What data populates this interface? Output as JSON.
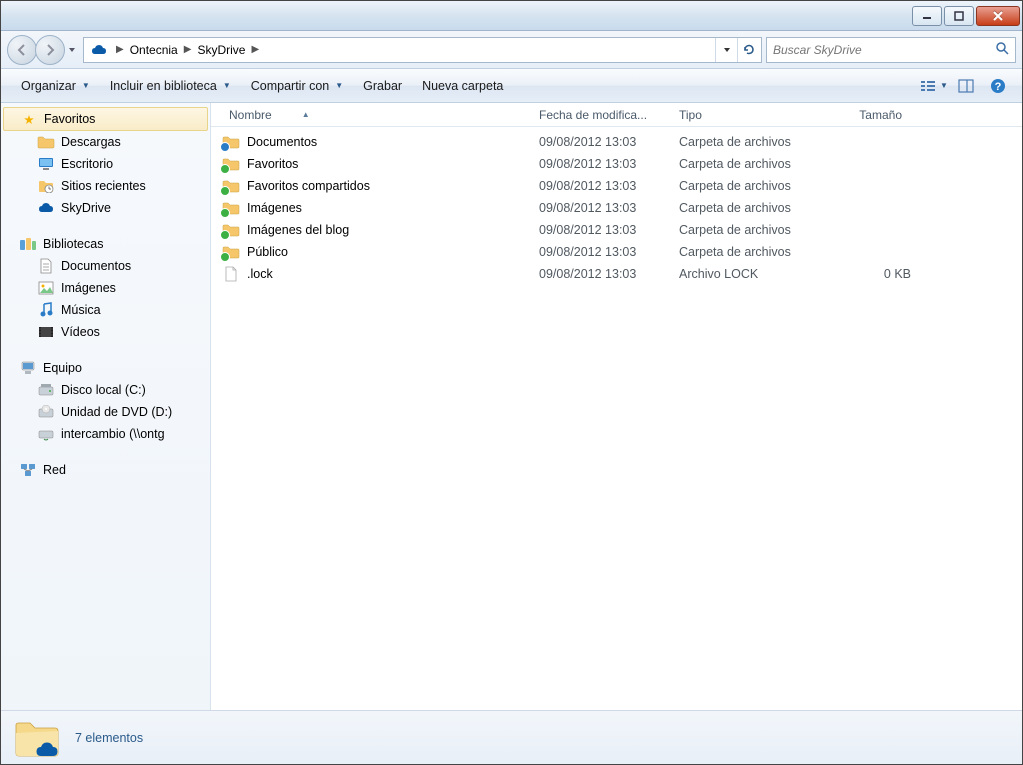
{
  "breadcrumb": [
    "Ontecnia",
    "SkyDrive"
  ],
  "search": {
    "placeholder": "Buscar SkyDrive"
  },
  "toolbar": {
    "organize": "Organizar",
    "include": "Incluir en biblioteca",
    "share": "Compartir con",
    "burn": "Grabar",
    "newfolder": "Nueva carpeta"
  },
  "sidebar": {
    "favorites": {
      "label": "Favoritos",
      "items": [
        "Descargas",
        "Escritorio",
        "Sitios recientes",
        "SkyDrive"
      ]
    },
    "libraries": {
      "label": "Bibliotecas",
      "items": [
        "Documentos",
        "Imágenes",
        "Música",
        "Vídeos"
      ]
    },
    "computer": {
      "label": "Equipo",
      "items": [
        "Disco local (C:)",
        "Unidad de DVD (D:)",
        "intercambio (\\\\ontg"
      ]
    },
    "network": {
      "label": "Red"
    }
  },
  "columns": {
    "name": "Nombre",
    "date": "Fecha de modifica...",
    "type": "Tipo",
    "size": "Tamaño"
  },
  "files": [
    {
      "name": "Documentos",
      "date": "09/08/2012 13:03",
      "type": "Carpeta de archivos",
      "size": "",
      "icon": "folder-sync"
    },
    {
      "name": "Favoritos",
      "date": "09/08/2012 13:03",
      "type": "Carpeta de archivos",
      "size": "",
      "icon": "folder-ok"
    },
    {
      "name": "Favoritos compartidos",
      "date": "09/08/2012 13:03",
      "type": "Carpeta de archivos",
      "size": "",
      "icon": "folder-ok"
    },
    {
      "name": "Imágenes",
      "date": "09/08/2012 13:03",
      "type": "Carpeta de archivos",
      "size": "",
      "icon": "folder-ok"
    },
    {
      "name": "Imágenes del blog",
      "date": "09/08/2012 13:03",
      "type": "Carpeta de archivos",
      "size": "",
      "icon": "folder-ok"
    },
    {
      "name": "Público",
      "date": "09/08/2012 13:03",
      "type": "Carpeta de archivos",
      "size": "",
      "icon": "folder-ok"
    },
    {
      "name": ".lock",
      "date": "09/08/2012 13:03",
      "type": "Archivo LOCK",
      "size": "0 KB",
      "icon": "file"
    }
  ],
  "status": {
    "text": "7 elementos"
  }
}
